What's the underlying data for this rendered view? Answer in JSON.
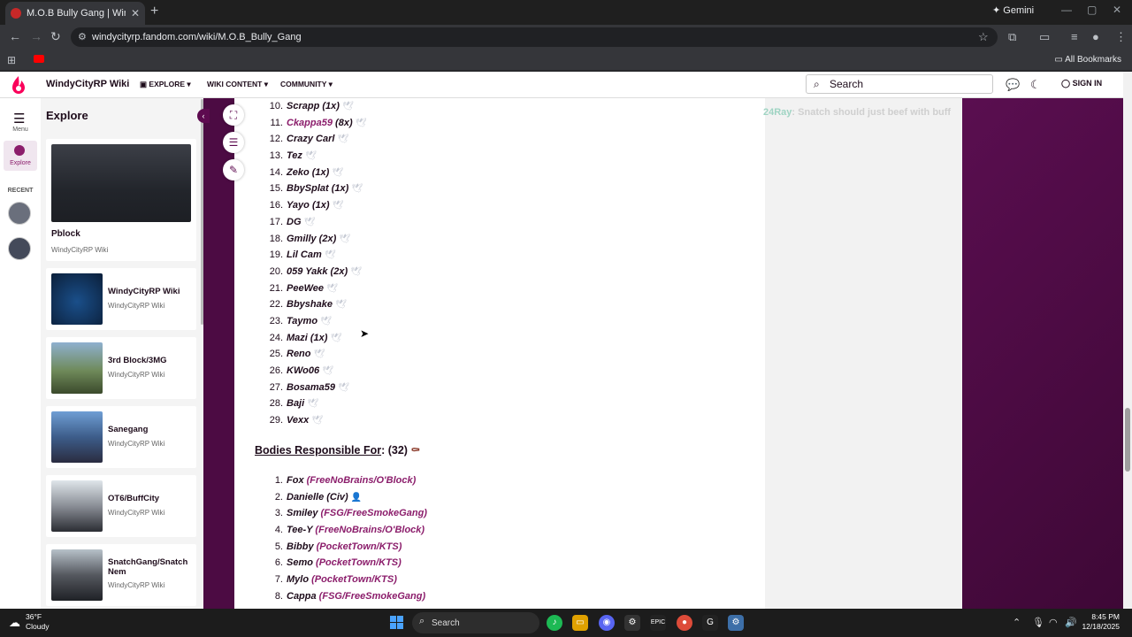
{
  "browser": {
    "tab_title": "M.O.B Bully Gang | WindyCityR",
    "tab_close": "✕",
    "new_tab": "+",
    "gemini_label": "Gemini",
    "url": "windycityrp.fandom.com/wiki/M.O.B_Bully_Gang",
    "all_bookmarks": "All Bookmarks"
  },
  "fandom_nav": {
    "wiki_name": "WindyCityRP Wiki",
    "menus": [
      "EXPLORE",
      "WIKI CONTENT",
      "COMMUNITY"
    ],
    "search_placeholder": "Search",
    "sign_in": "SIGN IN"
  },
  "rail": {
    "menu_label": "Menu",
    "explore_label": "Explore",
    "recent_label": "RECENT"
  },
  "explore": {
    "heading": "Explore",
    "featured": {
      "title": "Pblock",
      "subtitle": "WindyCityRP Wiki"
    },
    "cards": [
      {
        "title": "WindyCityRP Wiki",
        "subtitle": "WindyCityRP Wiki"
      },
      {
        "title": "3rd Block/3MG",
        "subtitle": "WindyCityRP Wiki"
      },
      {
        "title": "Sanegang",
        "subtitle": "WindyCityRP Wiki"
      },
      {
        "title": "OT6/BuffCity",
        "subtitle": "WindyCityRP Wiki"
      },
      {
        "title": "SnatchGang/Snatch Nem",
        "subtitle": "WindyCityRP Wiki"
      }
    ]
  },
  "chat_overlay": {
    "user": "24Ray",
    "message": ": Snatch should just beef with buff"
  },
  "article": {
    "members": [
      {
        "n": "10.",
        "name": "Scrapp (1x)"
      },
      {
        "n": "11.",
        "name": "Ckappa59",
        "extra": " (8x)",
        "link": true
      },
      {
        "n": "12.",
        "name": "Crazy Carl"
      },
      {
        "n": "13.",
        "name": "Tez"
      },
      {
        "n": "14.",
        "name": "Zeko (1x)"
      },
      {
        "n": "15.",
        "name": "BbySplat (1x)"
      },
      {
        "n": "16.",
        "name": "Yayo (1x)"
      },
      {
        "n": "17.",
        "name": "DG"
      },
      {
        "n": "18.",
        "name": "Gmilly (2x)"
      },
      {
        "n": "19.",
        "name": "Lil Cam"
      },
      {
        "n": "20.",
        "name": "059 Yakk (2x)"
      },
      {
        "n": "21.",
        "name": "PeeWee"
      },
      {
        "n": "22.",
        "name": "Bbyshake"
      },
      {
        "n": "23.",
        "name": "Taymo"
      },
      {
        "n": "24.",
        "name": "Mazi (1x)"
      },
      {
        "n": "25.",
        "name": "Reno"
      },
      {
        "n": "26.",
        "name": "KWo06"
      },
      {
        "n": "27.",
        "name": "Bosama59"
      },
      {
        "n": "28.",
        "name": "Baji"
      },
      {
        "n": "29.",
        "name": "Vexx"
      }
    ],
    "dove": "🕊",
    "bodies_heading": "Bodies Responsible For",
    "bodies_count": ": (32)",
    "bodies": [
      {
        "n": "1.",
        "name": "Fox",
        "aff": "FreeNoBrains/O'Block"
      },
      {
        "n": "2.",
        "name": "Danielle (Civ)",
        "aff": ""
      },
      {
        "n": "3.",
        "name": "Smiley",
        "aff": "FSG/FreeSmokeGang"
      },
      {
        "n": "4.",
        "name": "Tee-Y",
        "aff": "FreeNoBrains/O'Block"
      },
      {
        "n": "5.",
        "name": "Bibby",
        "aff": "PocketTown/KTS"
      },
      {
        "n": "6.",
        "name": "Semo",
        "aff": "PocketTown/KTS"
      },
      {
        "n": "7.",
        "name": "Mylo",
        "aff": "PocketTown/KTS"
      },
      {
        "n": "8.",
        "name": "Cappa",
        "aff": "FSG/FreeSmokeGang"
      }
    ]
  },
  "taskbar": {
    "temp": "36°F",
    "condition": "Cloudy",
    "search": "Search",
    "time": "8:45 PM",
    "date": "12/18/2025"
  },
  "colors": {
    "theme": "#4c0b43",
    "link": "#8b1d6b",
    "accent": "#5d0a4f"
  }
}
